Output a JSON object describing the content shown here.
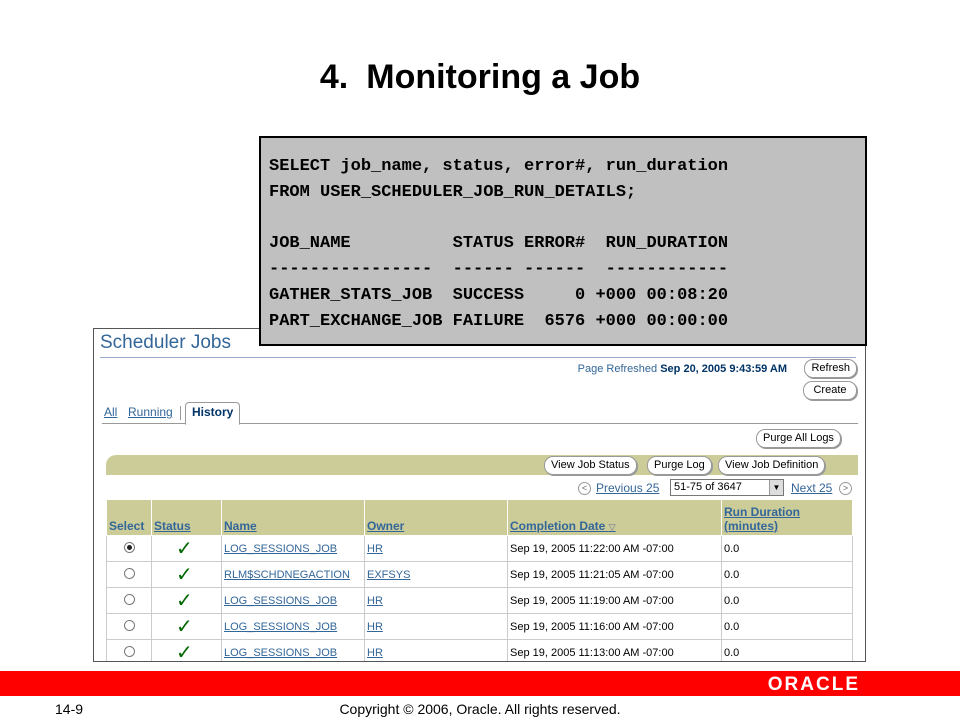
{
  "slide": {
    "number": "4.",
    "title": "Monitoring a Job",
    "page_number": "14-9",
    "copyright": "Copyright © 2006, Oracle. All rights reserved.",
    "logo_text": "ORACLE"
  },
  "sql": {
    "lines": [
      "SELECT job_name, status, error#, run_duration",
      "FROM USER_SCHEDULER_JOB_RUN_DETAILS;",
      "",
      "JOB_NAME          STATUS ERROR#  RUN_DURATION",
      "----------------  ------ ------  ------------",
      "GATHER_STATS_JOB  SUCCESS     0 +000 00:08:20",
      "PART_EXCHANGE_JOB FAILURE  6576 +000 00:00:00"
    ]
  },
  "window": {
    "title": "Scheduler Jobs",
    "page_refreshed_label": "Page Refreshed",
    "page_refreshed_value": "Sep 20, 2005 9:43:59 AM",
    "refresh_label": "Refresh",
    "create_label": "Create",
    "tabs": {
      "all": "All",
      "running": "Running",
      "history": "History"
    },
    "purge_all_label": "Purge All Logs",
    "view_status_label": "View Job Status",
    "purge_log_label": "Purge Log",
    "view_definition_label": "View Job Definition",
    "pager": {
      "previous": "Previous 25",
      "range": "51-75 of 3647",
      "next": "Next 25"
    },
    "table": {
      "headers": {
        "select": "Select",
        "status": "Status",
        "name": "Name",
        "owner": "Owner",
        "completion": "Completion Date",
        "duration_line1": "Run Duration",
        "duration_line2": "(minutes)"
      },
      "rows": [
        {
          "selected": true,
          "status_icon": "checkmark-icon",
          "name": "LOG_SESSIONS_JOB",
          "owner": "HR",
          "completion": "Sep 19, 2005 11:22:00 AM -07:00",
          "duration": "0.0"
        },
        {
          "selected": false,
          "status_icon": "checkmark-icon",
          "name": "RLM$SCHDNEGACTION",
          "owner": "EXFSYS",
          "completion": "Sep 19, 2005 11:21:05 AM -07:00",
          "duration": "0.0"
        },
        {
          "selected": false,
          "status_icon": "checkmark-icon",
          "name": "LOG_SESSIONS_JOB",
          "owner": "HR",
          "completion": "Sep 19, 2005 11:19:00 AM -07:00",
          "duration": "0.0"
        },
        {
          "selected": false,
          "status_icon": "checkmark-icon",
          "name": "LOG_SESSIONS_JOB",
          "owner": "HR",
          "completion": "Sep 19, 2005 11:16:00 AM -07:00",
          "duration": "0.0"
        },
        {
          "selected": false,
          "status_icon": "checkmark-icon",
          "name": "LOG_SESSIONS_JOB",
          "owner": "HR",
          "completion": "Sep 19, 2005 11:13:00 AM -07:00",
          "duration": "0.0"
        }
      ]
    }
  }
}
